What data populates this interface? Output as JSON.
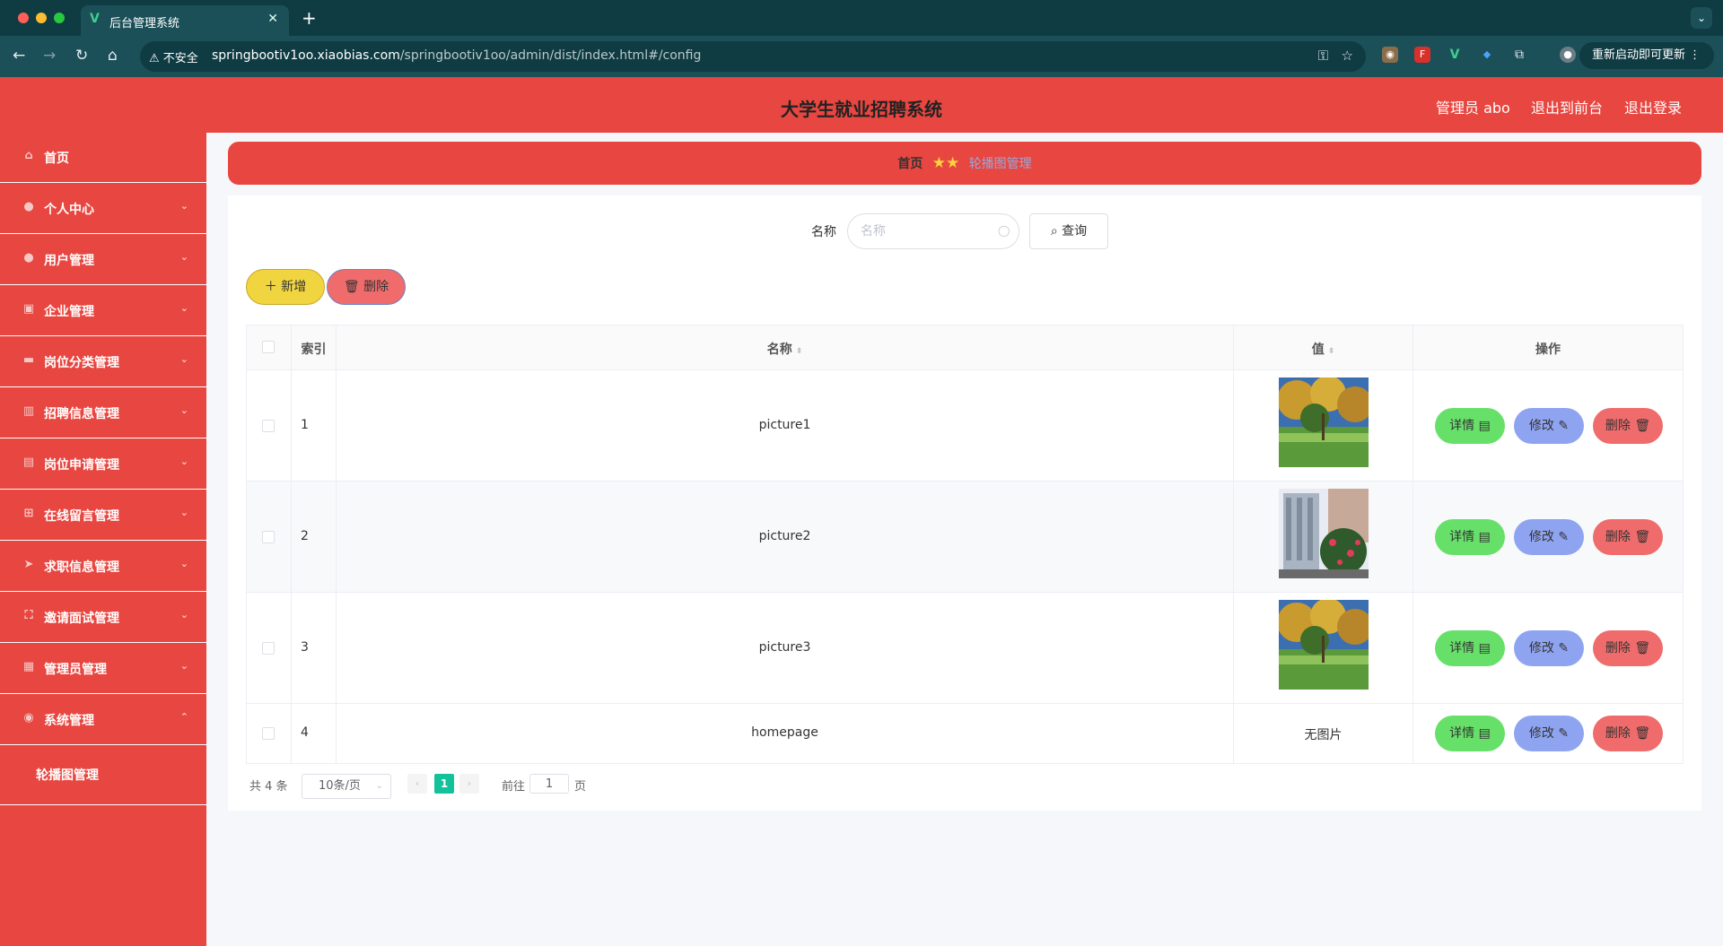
{
  "browser": {
    "tab_title": "后台管理系统",
    "tab_favicon": "V",
    "close_glyph": "✕",
    "newtab_glyph": "+",
    "insecure_label": "不安全",
    "url_host": "springbootiv1oo.xiaobias.com",
    "url_path": "/springbootiv1oo/admin/dist/index.html#/config",
    "update_label": "重新启动即可更新 ⋮"
  },
  "header": {
    "title": "大学生就业招聘系统",
    "admin_label": "管理员 abo",
    "front_link": "退出到前台",
    "logout_link": "退出登录"
  },
  "sidebar": {
    "items": [
      {
        "label": "首页",
        "icon": "home-icon"
      },
      {
        "label": "个人中心",
        "icon": "user-icon"
      },
      {
        "label": "用户管理",
        "icon": "user-icon"
      },
      {
        "label": "企业管理",
        "icon": "chart-icon"
      },
      {
        "label": "岗位分类管理",
        "icon": "monitor-icon"
      },
      {
        "label": "招聘信息管理",
        "icon": "bar-chart-icon"
      },
      {
        "label": "岗位申请管理",
        "icon": "briefcase-icon"
      },
      {
        "label": "在线留言管理",
        "icon": "grid-icon"
      },
      {
        "label": "求职信息管理",
        "icon": "send-icon"
      },
      {
        "label": "邀请面试管理",
        "icon": "crop-icon"
      },
      {
        "label": "管理员管理",
        "icon": "lock-icon"
      },
      {
        "label": "系统管理",
        "icon": "location-icon"
      }
    ],
    "sub_item": "轮播图管理"
  },
  "breadcrumb": {
    "home": "首页",
    "stars": "★★",
    "current": "轮播图管理"
  },
  "search": {
    "label": "名称",
    "placeholder": "名称",
    "query_button": "查询"
  },
  "toolbar": {
    "add_label": "新增",
    "delete_label": "删除"
  },
  "table": {
    "headers": {
      "index": "索引",
      "name": "名称",
      "value": "值",
      "actions": "操作"
    },
    "rows": [
      {
        "index": "1",
        "name": "picture1",
        "value": "",
        "image": "autumn-campus"
      },
      {
        "index": "2",
        "name": "picture2",
        "value": "",
        "image": "building-flowers"
      },
      {
        "index": "3",
        "name": "picture3",
        "value": "",
        "image": "autumn-campus"
      },
      {
        "index": "4",
        "name": "homepage",
        "value": "无图片",
        "image": ""
      }
    ],
    "actions": {
      "detail": "详情",
      "edit": "修改",
      "delete": "删除"
    }
  },
  "pagination": {
    "total": "共 4 条",
    "page_size": "10条/页",
    "current_page": "1",
    "goto_label": "前往",
    "goto_value": "1",
    "goto_suffix": "页"
  },
  "colors": {
    "primary_red": "#e84640",
    "detail_green": "#67e06a",
    "edit_blue": "#8ea4f0",
    "delete_red": "#f06b6b",
    "add_yellow": "#f0d440",
    "page_active": "#13c29a"
  }
}
